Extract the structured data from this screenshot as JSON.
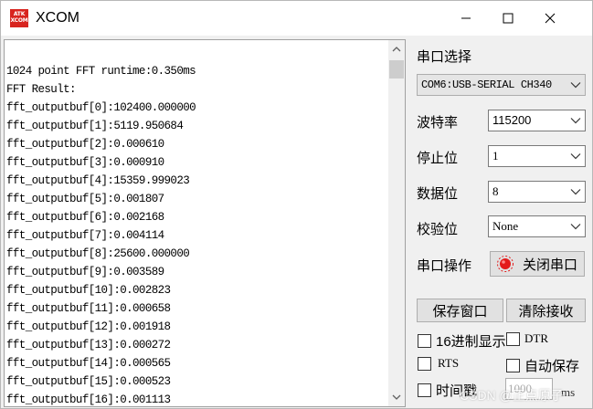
{
  "window": {
    "title": "XCOM",
    "logo_text": "ATK XCOM"
  },
  "output": {
    "lines": [
      "1024 point FFT runtime:0.350ms",
      "FFT Result:",
      "fft_outputbuf[0]:102400.000000",
      "fft_outputbuf[1]:5119.950684",
      "fft_outputbuf[2]:0.000610",
      "fft_outputbuf[3]:0.000910",
      "fft_outputbuf[4]:15359.999023",
      "fft_outputbuf[5]:0.001807",
      "fft_outputbuf[6]:0.002168",
      "fft_outputbuf[7]:0.004114",
      "fft_outputbuf[8]:25600.000000",
      "fft_outputbuf[9]:0.003589",
      "fft_outputbuf[10]:0.002823",
      "fft_outputbuf[11]:0.000658",
      "fft_outputbuf[12]:0.001918",
      "fft_outputbuf[13]:0.000272",
      "fft_outputbuf[14]:0.000565",
      "fft_outputbuf[15]:0.000523",
      "fft_outputbuf[16]:0.001113"
    ]
  },
  "panel": {
    "port_select_label": "串口选择",
    "port_value": "COM6:USB-SERIAL CH340",
    "baud_label": "波特率",
    "baud_value": "115200",
    "stop_label": "停止位",
    "stop_value": "1",
    "data_label": "数据位",
    "data_value": "8",
    "parity_label": "校验位",
    "parity_value": "None",
    "op_label": "串口操作",
    "close_port_label": "关闭串口",
    "save_window_label": "保存窗口",
    "clear_recv_label": "清除接收",
    "hex_display_label": "16进制显示",
    "dtr_label": "DTR",
    "rts_label": "RTS",
    "auto_save_label": "自动保存",
    "timestamp_label": "时间戳",
    "interval_value": "1000",
    "interval_unit": "ms"
  },
  "watermark": "CSDN @正点原子",
  "colors": {
    "logo_red": "#d8241f",
    "led_red": "#e31b1b"
  }
}
